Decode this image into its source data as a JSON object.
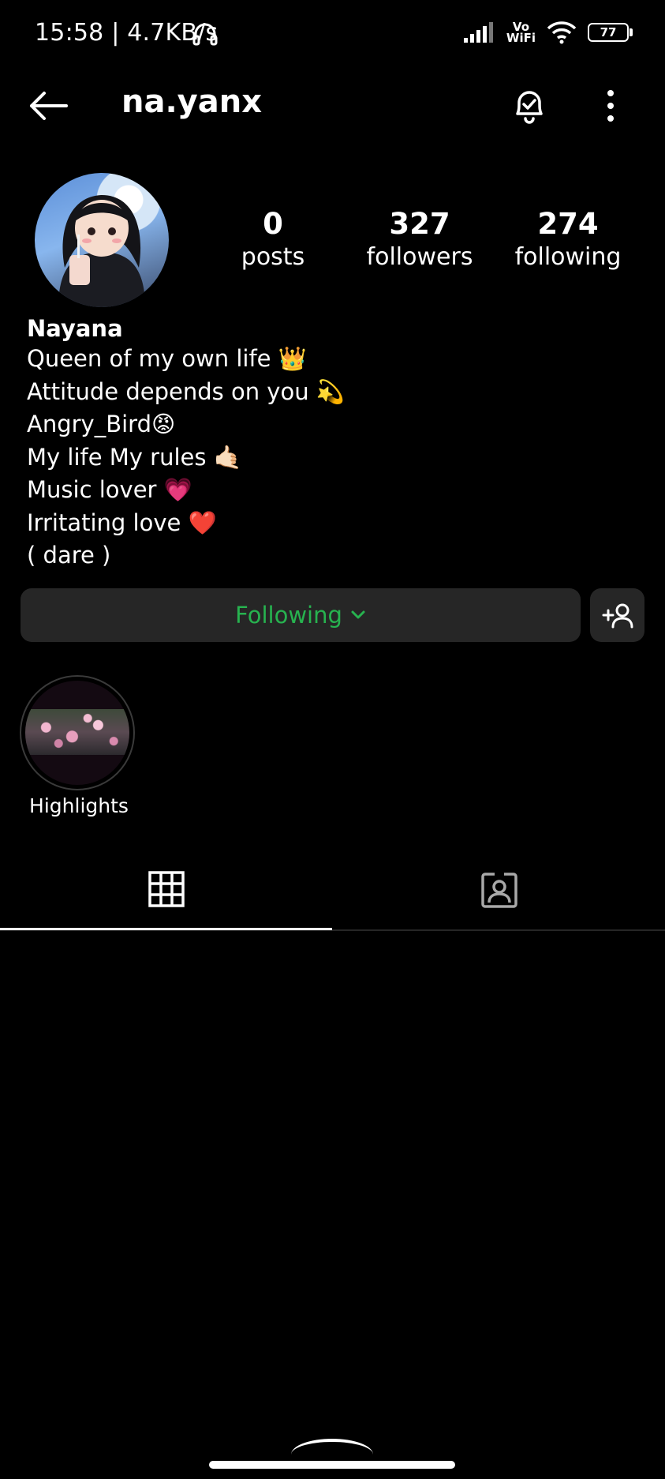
{
  "status_bar": {
    "time_speed": "15:58 | 4.7KB/s",
    "vowifi_top": "Vo",
    "vowifi_bottom": "WiFi",
    "battery": "77"
  },
  "header": {
    "username": "na.yanx"
  },
  "stats": {
    "posts": {
      "count": "0",
      "label": "posts"
    },
    "followers": {
      "count": "327",
      "label": "followers"
    },
    "following": {
      "count": "274",
      "label": "following"
    }
  },
  "bio": {
    "name": "Nayana",
    "lines": [
      "Queen of my own life 👑",
      "Attitude depends on you 💫",
      "Angry_Bird😡",
      "My life My rules 🤙🏻",
      "Music lover 💗",
      "Irritating love ❤️",
      "( dare )"
    ]
  },
  "actions": {
    "following_label": "Following"
  },
  "highlights": [
    {
      "label": "Highlights"
    }
  ],
  "colors": {
    "background": "#000000",
    "button_bg": "#262626",
    "following_green": "#27b24f"
  }
}
